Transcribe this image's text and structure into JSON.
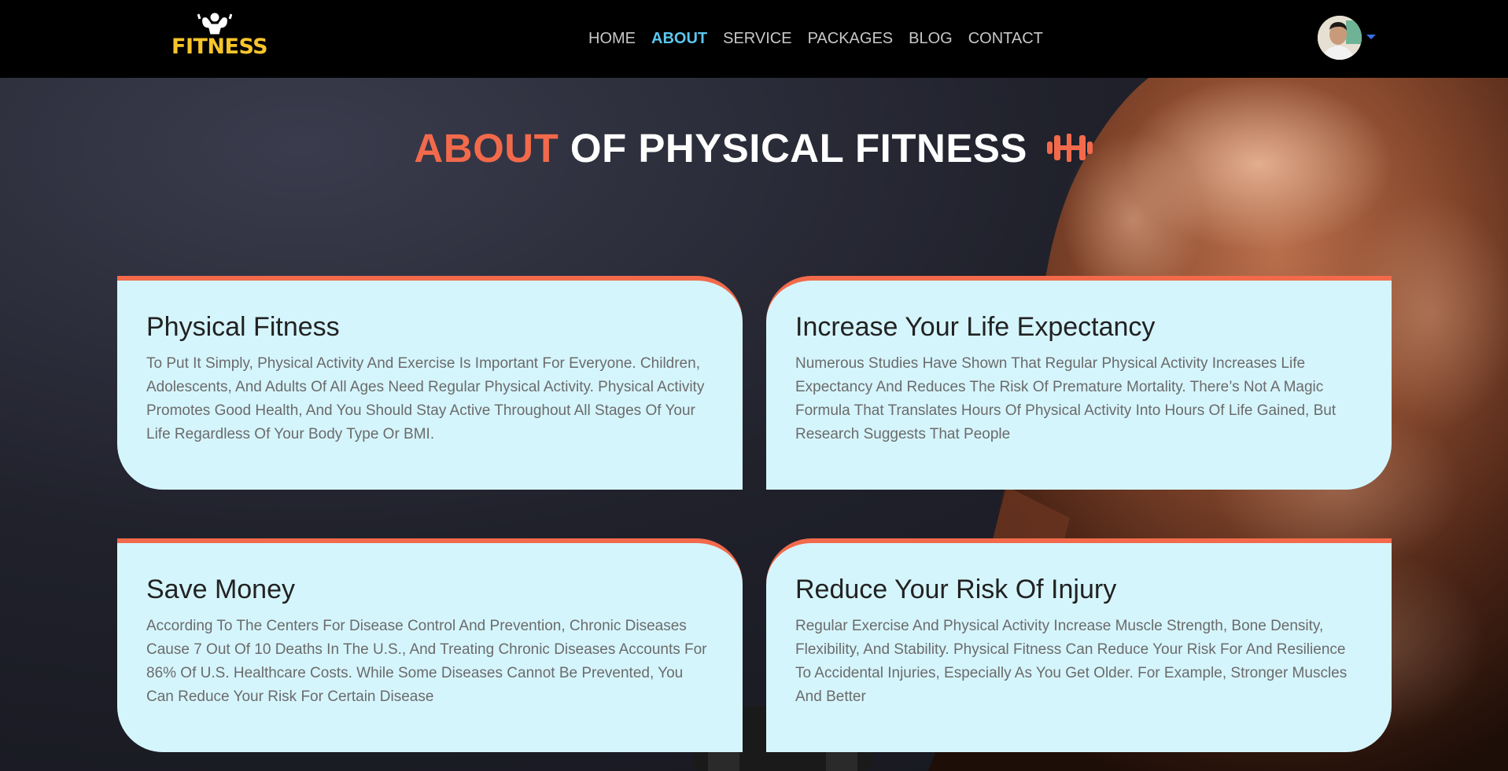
{
  "brand": {
    "logo_text": "FITNESS"
  },
  "nav": {
    "items": [
      {
        "label": "HOME",
        "active": false
      },
      {
        "label": "ABOUT",
        "active": true
      },
      {
        "label": "SERVICE",
        "active": false
      },
      {
        "label": "PACKAGES",
        "active": false
      },
      {
        "label": "BLOG",
        "active": false
      },
      {
        "label": "CONTACT",
        "active": false
      }
    ]
  },
  "page": {
    "title_accent": "ABOUT",
    "title_rest": "OF PHYSICAL FITNESS"
  },
  "cards": [
    {
      "title": "Physical Fitness",
      "text": "To Put It Simply, Physical Activity And Exercise Is Important For Everyone. Children, Adolescents, And Adults Of All Ages Need Regular Physical Activity. Physical Activity Promotes Good Health, And You Should Stay Active Throughout All Stages Of Your Life Regardless Of Your Body Type Or BMI."
    },
    {
      "title": "Increase Your Life Expectancy",
      "text": "Numerous Studies Have Shown That Regular Physical Activity Increases Life Expectancy And Reduces The Risk Of Premature Mortality. There’s Not A Magic Formula That Translates Hours Of Physical Activity Into Hours Of Life Gained, But Research Suggests That People"
    },
    {
      "title": "Save Money",
      "text": "According To The Centers For Disease Control And Prevention, Chronic Diseases Cause 7 Out Of 10 Deaths In The U.S., And Treating Chronic Diseases Accounts For 86% Of U.S. Healthcare Costs. While Some Diseases Cannot Be Prevented, You Can Reduce Your Risk For Certain Disease"
    },
    {
      "title": "Reduce Your Risk Of Injury",
      "text": "Regular Exercise And Physical Activity Increase Muscle Strength, Bone Density, Flexibility, And Stability. Physical Fitness Can Reduce Your Risk For And Resilience To Accidental Injuries, Especially As You Get Older. For Example, Stronger Muscles And Better"
    }
  ],
  "colors": {
    "accent": "#f26a4b",
    "nav_active": "#5cc6ee",
    "card_bg": "#d5f5fc",
    "logo": "#f7c52b"
  },
  "icons": {
    "title_icon": "dumbbell-icon",
    "profile_caret": "caret-down-icon"
  }
}
